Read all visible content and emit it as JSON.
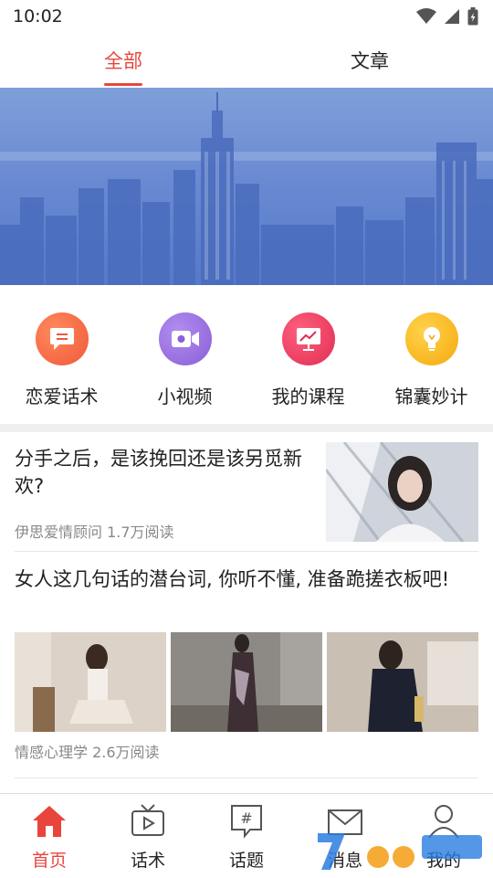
{
  "status_bar": {
    "time": "10:02"
  },
  "tabs": [
    {
      "label": "全部",
      "active": true
    },
    {
      "label": "文章",
      "active": false
    }
  ],
  "quick_actions": [
    {
      "label": "恋爱话术",
      "icon": "chat-bubble-icon",
      "color": "#f26b4a"
    },
    {
      "label": "小视频",
      "icon": "video-camera-icon",
      "color": "#9a6fe0"
    },
    {
      "label": "我的课程",
      "icon": "presentation-icon",
      "color": "#ef3f62"
    },
    {
      "label": "锦囊妙计",
      "icon": "lightbulb-icon",
      "color": "#f7b81c"
    }
  ],
  "articles": [
    {
      "title": "分手之后，是该挽回还是该另觅新欢?",
      "meta": "伊思爱情顾问  1.7万阅读"
    },
    {
      "title": "女人这几句话的潜台词, 你听不懂, 准备跪搓衣板吧!",
      "meta": "情感心理学  2.6万阅读"
    }
  ],
  "bottom_nav": [
    {
      "label": "首页",
      "icon": "home-icon",
      "active": true
    },
    {
      "label": "话术",
      "icon": "tv-icon",
      "active": false
    },
    {
      "label": "话题",
      "icon": "hashtag-bubble-icon",
      "active": false
    },
    {
      "label": "消息",
      "icon": "mail-icon",
      "active": false
    },
    {
      "label": "我的",
      "icon": "user-icon",
      "active": false
    }
  ],
  "colors": {
    "accent": "#e8453c",
    "banner": "#6a8bd2"
  }
}
